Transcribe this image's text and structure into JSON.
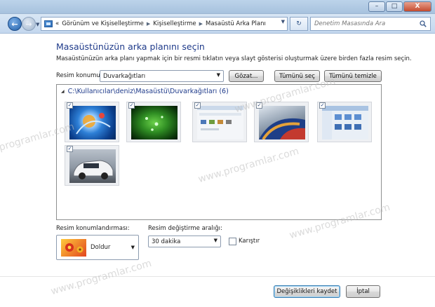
{
  "window": {
    "controls": {
      "minimize": "–",
      "maximize": "□",
      "close": "X"
    }
  },
  "nav": {
    "back_glyph": "←",
    "forward_glyph": "→",
    "breadcrumb": [
      "Görünüm ve Kişiselleştirme",
      "Kişiselleştirme",
      "Masaüstü Arka Planı"
    ],
    "overflow": "«",
    "search_placeholder": "Denetim Masasında Ara",
    "refresh_glyph": "↻"
  },
  "page": {
    "title": "Masaüstünüzün arka planını seçin",
    "description": "Masaüstünüzün arka planı yapmak için bir resmi tıklatın veya slayt gösterisi oluşturmak üzere birden fazla resim seçin."
  },
  "location": {
    "label": "Resim konumu:",
    "value": "Duvarkağıtları",
    "browse_button": "Gözat...",
    "select_all_button": "Tümünü seç",
    "clear_all_button": "Tümünü temizle"
  },
  "gallery": {
    "folder_path": "C:\\Kullanıcılar\\deniz\\Masaüstü\\Duvarkağıtları (6)",
    "images": [
      {
        "name": "blue-abstract-wallpaper",
        "checked": true
      },
      {
        "name": "green-leaf-droplets-wallpaper",
        "checked": true
      },
      {
        "name": "desktop-screenshot-wallpaper",
        "checked": true
      },
      {
        "name": "car-fender-wallpaper",
        "checked": true
      },
      {
        "name": "explorer-screenshot-wallpaper",
        "checked": true
      },
      {
        "name": "white-sports-car-wallpaper",
        "checked": true
      }
    ]
  },
  "position": {
    "label": "Resim konumlandırması:",
    "value": "Doldur"
  },
  "interval": {
    "label": "Resim değiştirme aralığı:",
    "value": "30 dakika",
    "shuffle_label": "Karıştır",
    "shuffle_checked": false
  },
  "actions": {
    "save_button": "Değişiklikleri kaydet",
    "cancel_button": "İptal"
  },
  "watermark_text": "www.programlar.com"
}
